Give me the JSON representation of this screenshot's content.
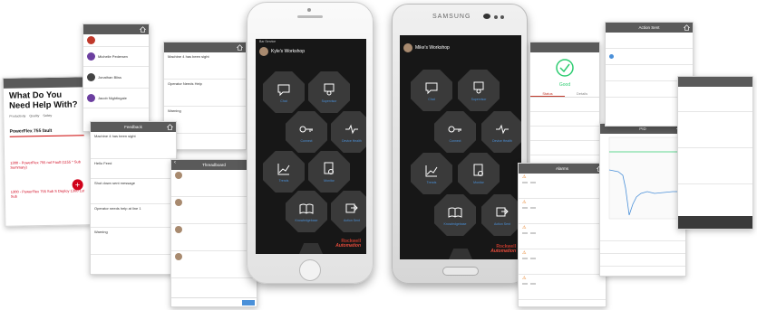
{
  "left_help": {
    "header": "",
    "heading": "What Do You Need Help With?",
    "options": [
      "Productivity",
      "Quality",
      "Safety"
    ],
    "link": "PowerFlex 755 fault",
    "entries": [
      "1300 - PowerFlex 755 not Fault (1155 * Sub Summary)",
      "1300 - PowerFlex 755 Sub S Deploy 1300 1st Sub"
    ]
  },
  "users": {
    "header": "",
    "items": [
      {
        "name": "",
        "sub": ""
      },
      {
        "name": "Michelle Pedersen",
        "sub": ""
      },
      {
        "name": "Jonathan Bliss",
        "sub": ""
      },
      {
        "name": "Jacob Nightingale",
        "sub": ""
      }
    ]
  },
  "issues": {
    "header": "",
    "items": [
      {
        "title": "Machine 4 has been sight",
        "sub": ""
      },
      {
        "title": "Operator Needs Help",
        "sub": ""
      },
      {
        "title": "Warning",
        "sub": ""
      }
    ]
  },
  "feedback": {
    "header": "Feedback",
    "items": [
      {
        "title": "Machine 4 has been sight",
        "sub": ""
      },
      {
        "title": "Hello Feed",
        "sub": ""
      },
      {
        "title": "Shot down sent message",
        "sub": ""
      },
      {
        "title": "Operator needs help at line 1",
        "sub": ""
      },
      {
        "title": "Warning",
        "sub": ""
      }
    ]
  },
  "threadboard": {
    "header": "Threadboard",
    "items": [
      {
        "who": "",
        "text": "",
        "link": ""
      },
      {
        "who": "",
        "text": "",
        "link": ""
      },
      {
        "who": "",
        "text": "",
        "link": ""
      },
      {
        "who": "",
        "text": "",
        "link": ""
      }
    ]
  },
  "phone1": {
    "carrier": "Bar Service",
    "time": "",
    "user_name": "Kyle's Workshop",
    "user_sub": "",
    "right_label": "",
    "tiles": [
      "Chat",
      "Supervisor",
      "Connect",
      "Device Health",
      "Trends",
      "Monitor",
      "Knowledgebase",
      "Action Sent"
    ],
    "brand1": "Rockwell",
    "brand2": "Automation"
  },
  "phone2": {
    "carrier": "",
    "time": "",
    "user_name": "Mike's Workshop",
    "user_sub": "",
    "right_label": "",
    "tiles": [
      "Chat",
      "Supervisor",
      "Connect",
      "Device Health",
      "Trends",
      "Monitor",
      "Knowledgebase",
      "Action Sent"
    ],
    "brand1": "Rockwell",
    "brand2": "Automation",
    "maker": "SAMSUNG"
  },
  "status_card": {
    "header": "",
    "state": "Good",
    "tabs": [
      "Status",
      "Details"
    ],
    "fields": [
      "",
      "",
      "",
      ""
    ]
  },
  "alarms": {
    "header": "Alarms",
    "items": [
      {
        "title": "",
        "sub": ""
      },
      {
        "title": "",
        "sub": ""
      },
      {
        "title": "",
        "sub": ""
      },
      {
        "title": "",
        "sub": ""
      },
      {
        "title": "",
        "sub": ""
      }
    ],
    "btn1": "",
    "btn2": ""
  },
  "trend": {
    "header": "PID",
    "colors": {
      "line": "#4a90d9",
      "setpoint": "#2ecc71"
    }
  },
  "action": {
    "header": "Action Sent",
    "items": [
      "",
      "",
      "",
      ""
    ]
  },
  "right_detail": {
    "header": "",
    "fields": [
      {
        "label": "",
        "value": ""
      },
      {
        "label": "",
        "value": ""
      },
      {
        "label": "",
        "value": ""
      }
    ]
  }
}
